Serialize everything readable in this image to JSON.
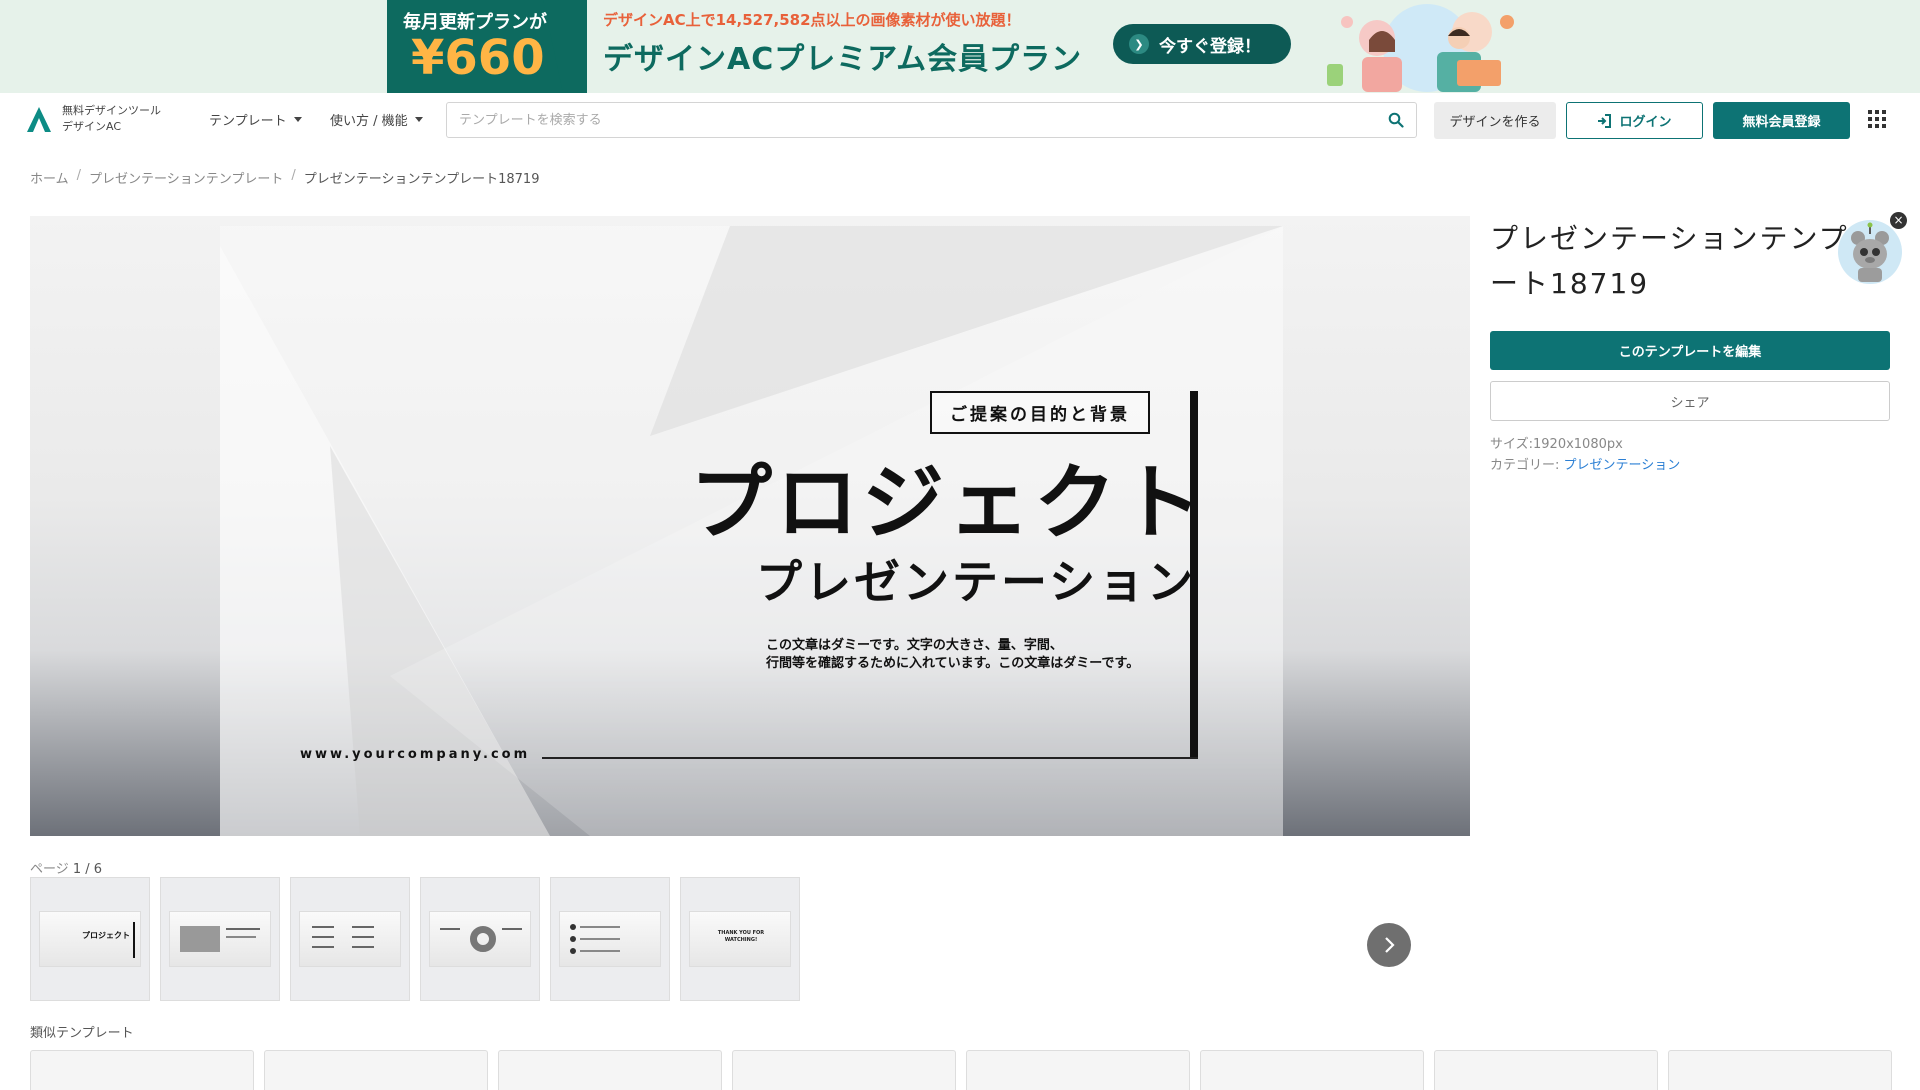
{
  "banner": {
    "monthly_label": "毎月更新プランが",
    "price": "¥660",
    "unlimited_text": "デザインAC上で14,527,582点以上の画像素材が使い放題！",
    "plan_title": "デザインACプレミアム会員プラン",
    "cta_label": "今すぐ登録！"
  },
  "header": {
    "logo_line1": "無料デザインツール",
    "logo_line2": "デザインAC",
    "nav_templates": "テンプレート",
    "nav_howto": "使い方 / 機能",
    "search_placeholder": "テンプレートを検索する",
    "create_label": "デザインを作る",
    "login_label": "ログイン",
    "signup_label": "無料会員登録"
  },
  "breadcrumb": {
    "items": [
      "ホーム",
      "プレゼンテーションテンプレート",
      "プレゼンテーションテンプレート18719"
    ]
  },
  "slide": {
    "tag": "ご提案の目的と背景",
    "title": "プロジェクト",
    "subtitle": "プレゼンテーション",
    "body_line1": "この文章はダミーです。文字の大きさ、量、字間、",
    "body_line2": "行間等を確認するために入れています。この文章はダミーです。",
    "url": "www.yourcompany.com"
  },
  "pages": {
    "label": "ページ",
    "current": "1 / 6",
    "thumb_texts": [
      "プロジェクト",
      "",
      "",
      "",
      "",
      "THANK YOU FOR WATCHING!"
    ]
  },
  "similar": {
    "label": "類似テンプレート"
  },
  "detail": {
    "title": "プレゼンテーションテンプレート18719",
    "edit_label": "このテンプレートを編集",
    "share_label": "シェア",
    "size_label": "サイズ:",
    "size_value": "1920x1080px",
    "category_label": "カテゴリー:",
    "category_value": "プレゼンテーション"
  },
  "colors": {
    "brand": "#0d7374",
    "banner_bg": "#e6f2ea",
    "banner_dark": "#0d6a5f",
    "price": "#ffb545",
    "link": "#2b7fd4"
  }
}
